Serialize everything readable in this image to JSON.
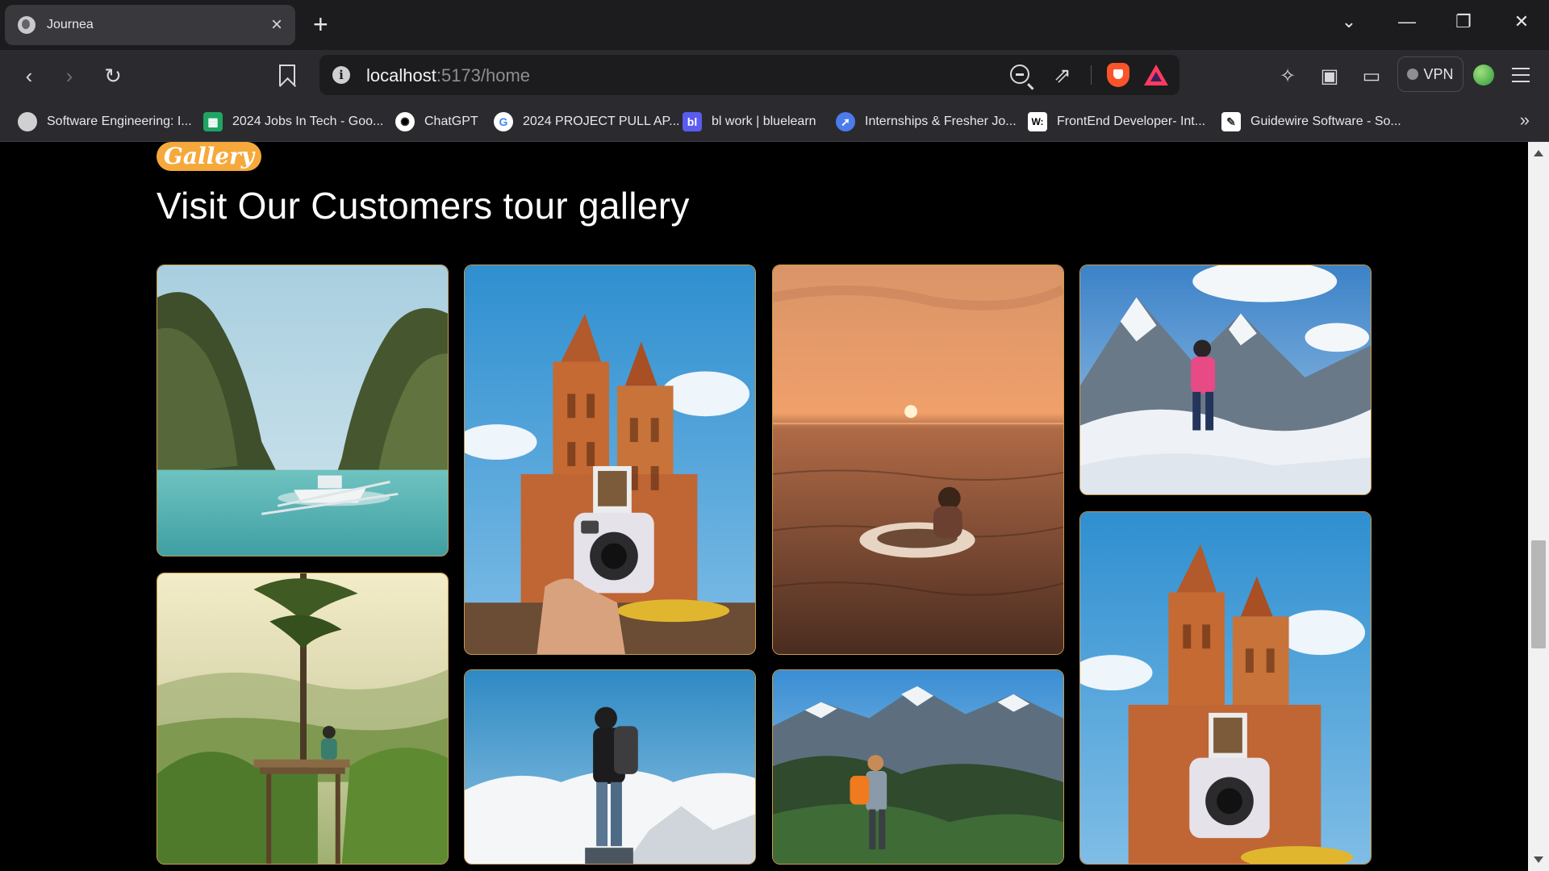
{
  "browser": {
    "tab_title": "Journea",
    "new_tab_symbol": "+",
    "url_host": "localhost",
    "url_path": ":5173/home",
    "vpn_label": "VPN",
    "bookmarks": [
      {
        "label": "Software Engineering: I...",
        "icon": "globe-icon",
        "color": "#d0d0d3"
      },
      {
        "label": "2024 Jobs In Tech - Goo...",
        "icon": "sheets-icon",
        "color": "#1fa463"
      },
      {
        "label": "ChatGPT",
        "icon": "chatgpt-icon",
        "color": "#ffffff"
      },
      {
        "label": "2024 PROJECT PULL AP...",
        "icon": "google-icon",
        "color": "#ffffff"
      },
      {
        "label": "bl work | bluelearn",
        "icon": "bluelearn-icon",
        "color": "#5b5bf0"
      },
      {
        "label": "Internships & Fresher Jo...",
        "icon": "rocket-icon",
        "color": "#4b7bec"
      },
      {
        "label": "FrontEnd Developer- Int...",
        "icon": "w-icon",
        "color": "#ffffff"
      },
      {
        "label": "Guidewire Software - So...",
        "icon": "pen-icon",
        "color": "#ffffff"
      }
    ]
  },
  "gallery": {
    "badge": "Gallery",
    "heading": "Visit Our Customers tour gallery",
    "accent_color": "#f6a93b",
    "images": [
      {
        "name": "lagoon-boat-image",
        "subject": "boat in turquoise lagoon between cliffs"
      },
      {
        "name": "tree-platform-image",
        "subject": "person sitting on tree platform over valley"
      },
      {
        "name": "cathedral-camera-image",
        "subject": "instant camera held in front of cathedral"
      },
      {
        "name": "hiker-clouds-image",
        "subject": "backpacker standing above clouds"
      },
      {
        "name": "sunset-sea-image",
        "subject": "person floating in sea at sunset"
      },
      {
        "name": "hiker-mountains-image",
        "subject": "hiker with orange backpack facing mountains"
      },
      {
        "name": "snow-climber-image",
        "subject": "climber in pink jacket on snowy mountain"
      },
      {
        "name": "cathedral-camera-image-2",
        "subject": "instant camera held in front of cathedral"
      }
    ]
  }
}
